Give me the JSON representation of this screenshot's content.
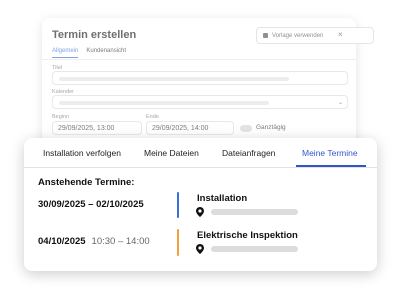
{
  "background_dialog": {
    "title": "Termin erstellen",
    "template_button": "Vorlage verwenden",
    "close": "×",
    "tabs": [
      "Allgemein",
      "Kundenansicht"
    ],
    "fields": {
      "title_label": "Titel",
      "calendar_label": "Kalender",
      "start_label": "Beginn",
      "start_value": "29/09/2025, 13:00",
      "end_label": "Ende",
      "end_value": "29/09/2025, 14:00",
      "all_day_label": "Ganztägig"
    }
  },
  "panel": {
    "tabs": [
      "Installation verfolgen",
      "Meine Dateien",
      "Dateianfragen",
      "Meine Termine"
    ],
    "active_tab": "Meine Termine",
    "section_title": "Anstehende Termine:",
    "appointments": [
      {
        "date": "30/09/2025 – 02/10/2025",
        "time": "",
        "title": "Installation",
        "accent": "#3a6fd8"
      },
      {
        "date": "04/10/2025",
        "time": "10:30 – 14:00",
        "title": "Elektrische Inspektion",
        "accent": "#f0a13a"
      }
    ]
  },
  "icons": {
    "location": "map-pin-icon",
    "close": "close-icon",
    "template": "lock-icon",
    "dropdown": "chevron-down-icon"
  }
}
